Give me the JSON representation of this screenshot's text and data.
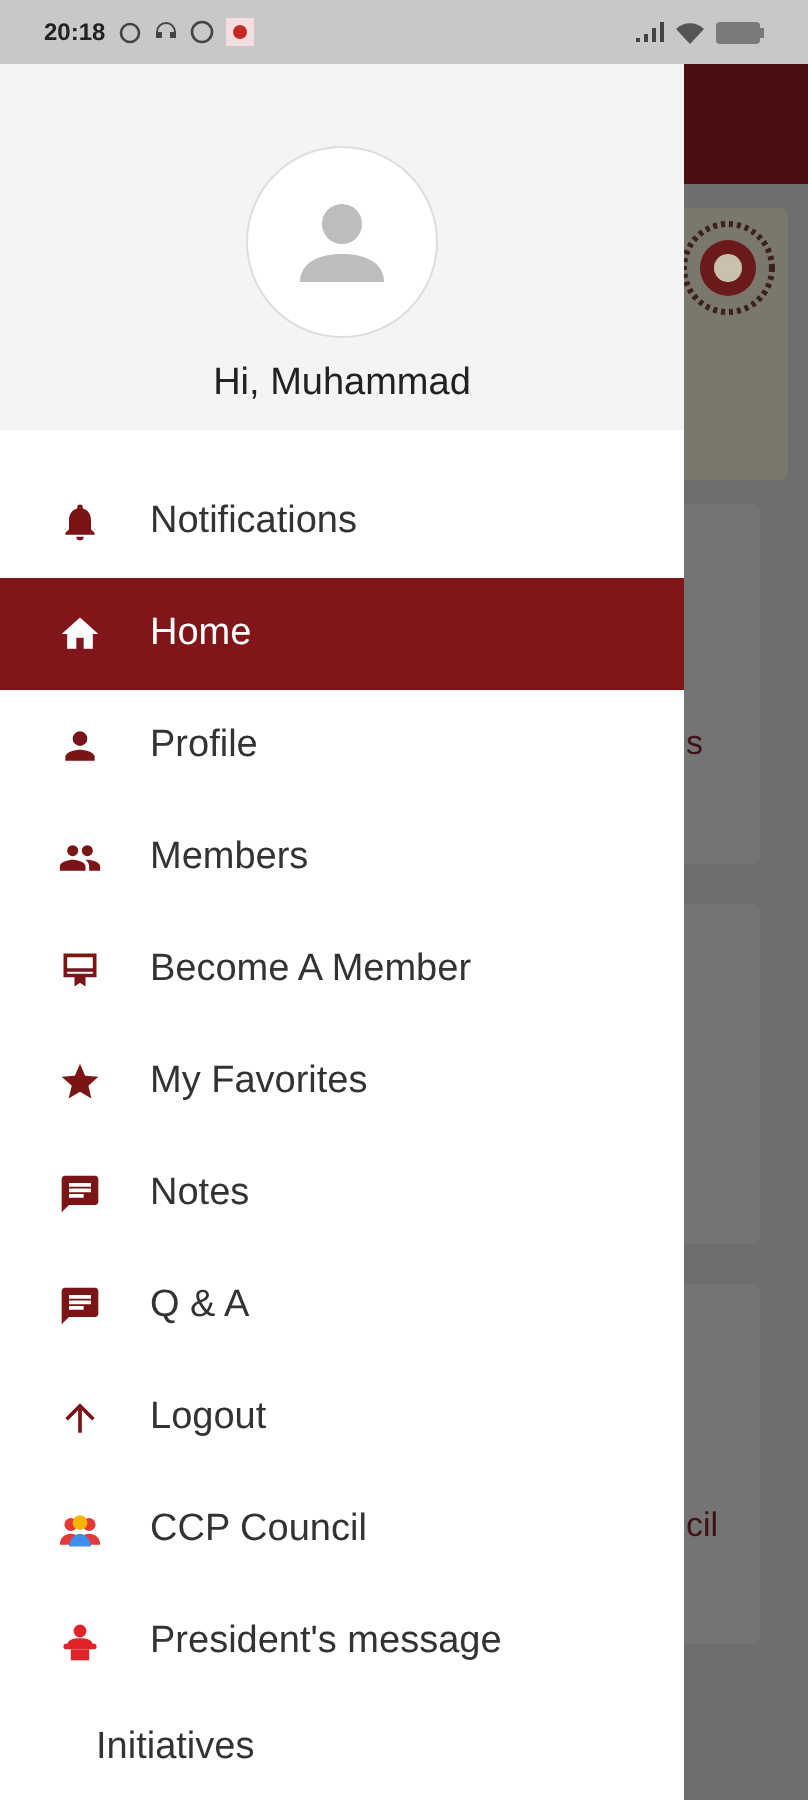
{
  "status_bar": {
    "time": "20:18"
  },
  "drawer": {
    "greeting": "Hi, Muhammad",
    "items": [
      {
        "label": "Notifications",
        "kind": "icon",
        "selected": false
      },
      {
        "label": "Home",
        "kind": "icon",
        "selected": true
      },
      {
        "label": "Profile",
        "kind": "icon",
        "selected": false
      },
      {
        "label": "Members",
        "kind": "icon",
        "selected": false
      },
      {
        "label": "Become A Member",
        "kind": "icon",
        "selected": false
      },
      {
        "label": "My Favorites",
        "kind": "icon",
        "selected": false
      },
      {
        "label": "Notes",
        "kind": "icon",
        "selected": false
      },
      {
        "label": "Q & A",
        "kind": "icon",
        "selected": false
      },
      {
        "label": "Logout",
        "kind": "icon",
        "selected": false
      },
      {
        "label": "CCP Council",
        "kind": "icon",
        "selected": false
      },
      {
        "label": "President's message",
        "kind": "icon",
        "selected": false
      },
      {
        "label": "Initiatives",
        "kind": "plain",
        "selected": false
      }
    ]
  },
  "background_page": {
    "fragments": [
      "s",
      "cil"
    ]
  }
}
